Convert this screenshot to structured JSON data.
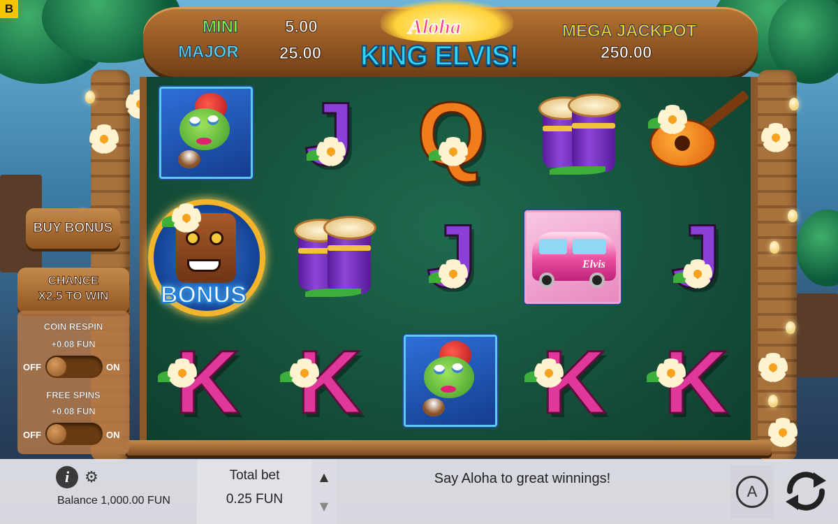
{
  "brand_badge": "B",
  "jackpots": {
    "mini": {
      "label": "MINI",
      "value": "5.00",
      "color": "#8cf04a"
    },
    "major": {
      "label": "MAJOR",
      "value": "25.00",
      "color": "#5fd6f4"
    },
    "mega": {
      "label": "MEGA JACKPOT",
      "value": "250.00",
      "color": "#ffd23a"
    }
  },
  "logo": {
    "line1": "Aloha",
    "line2": "KING ELVIS!"
  },
  "reels": [
    [
      "frog",
      "bonus",
      "K"
    ],
    [
      "J",
      "drums",
      "K"
    ],
    [
      "Q",
      "J",
      "frog"
    ],
    [
      "drums",
      "van",
      "K"
    ],
    [
      "guitar",
      "J",
      "K"
    ]
  ],
  "symbols": {
    "bonus_label": "BONUS",
    "van_label": "Elvis"
  },
  "side": {
    "buy_bonus": "BUY BONUS",
    "chance_line1": "CHANCE",
    "chance_line2": "X2.5 TO WIN",
    "coin_respin": {
      "title": "COIN RESPIN",
      "price": "+0.08 FUN",
      "off": "OFF",
      "on": "ON",
      "state": "off"
    },
    "free_spins": {
      "title": "FREE SPINS",
      "price": "+0.08 FUN",
      "off": "OFF",
      "on": "ON",
      "state": "off"
    }
  },
  "bottom": {
    "balance": "Balance 1,000.00 FUN",
    "total_bet_label": "Total bet",
    "total_bet_value": "0.25 FUN",
    "message": "Say Aloha to great winnings!",
    "icons": {
      "info": "info-icon",
      "settings": "gear-icon",
      "up": "arrow-up-icon",
      "down": "arrow-down-icon",
      "autoplay": "autoplay-icon",
      "spin": "spin-icon"
    },
    "autoplay_glyph": "A"
  }
}
